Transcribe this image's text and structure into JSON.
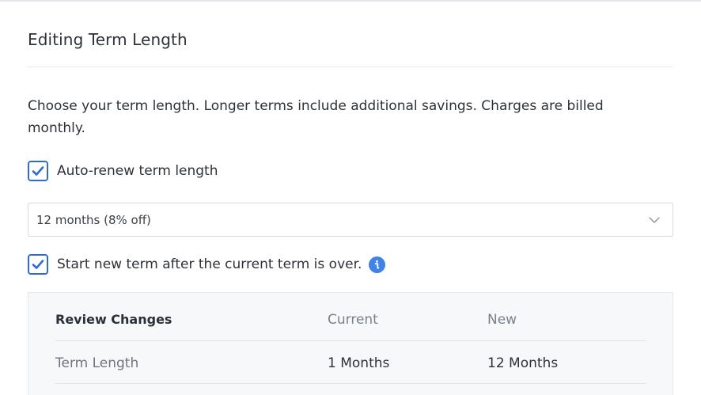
{
  "title": "Editing Term Length",
  "description": "Choose your term length. Longer terms include additional savings. Charges are billed monthly.",
  "auto_renew": {
    "label": "Auto-renew term length",
    "checked": true
  },
  "term_select": {
    "value": "12 months (8% off)"
  },
  "start_new": {
    "label": "Start new term after the current term is over.",
    "checked": true
  },
  "review": {
    "header": {
      "col1": "Review Changes",
      "col2": "Current",
      "col3": "New"
    },
    "rows": [
      {
        "label": "Term Length",
        "current": "1 Months",
        "new": "12 Months"
      }
    ]
  },
  "colors": {
    "accent": "#2f6bd7",
    "info": "#3f82e8"
  },
  "icons": [
    "checkmark-icon",
    "chevron-down-icon",
    "info-icon"
  ]
}
